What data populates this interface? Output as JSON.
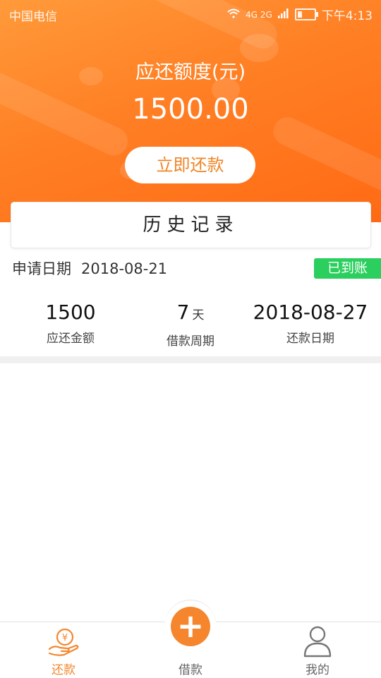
{
  "status_bar": {
    "carrier": "中国电信",
    "network": "4G 2G",
    "time": "下午4:13"
  },
  "header": {
    "due_label": "应还额度(元)",
    "due_amount": "1500.00",
    "repay_button": "立即还款"
  },
  "history": {
    "title": "历史记录"
  },
  "record": {
    "apply_label": "申请日期",
    "apply_date": "2018-08-21",
    "status": "已到账",
    "stats": [
      {
        "value": "1500",
        "unit": "",
        "label": "应还金额"
      },
      {
        "value": "7",
        "unit": "天",
        "label": "借款周期"
      },
      {
        "value": "2018-08-27",
        "unit": "",
        "label": "还款日期"
      }
    ]
  },
  "tabbar": {
    "tabs": [
      {
        "label": "还款",
        "icon": "repay-hand-yen-icon",
        "active": true
      },
      {
        "label": "借款",
        "icon": "plus-icon",
        "active": false
      },
      {
        "label": "我的",
        "icon": "user-icon",
        "active": false
      }
    ]
  },
  "colors": {
    "accent": "#f5862d",
    "status_green": "#2bcf5e",
    "inactive_tab": "#666666"
  }
}
